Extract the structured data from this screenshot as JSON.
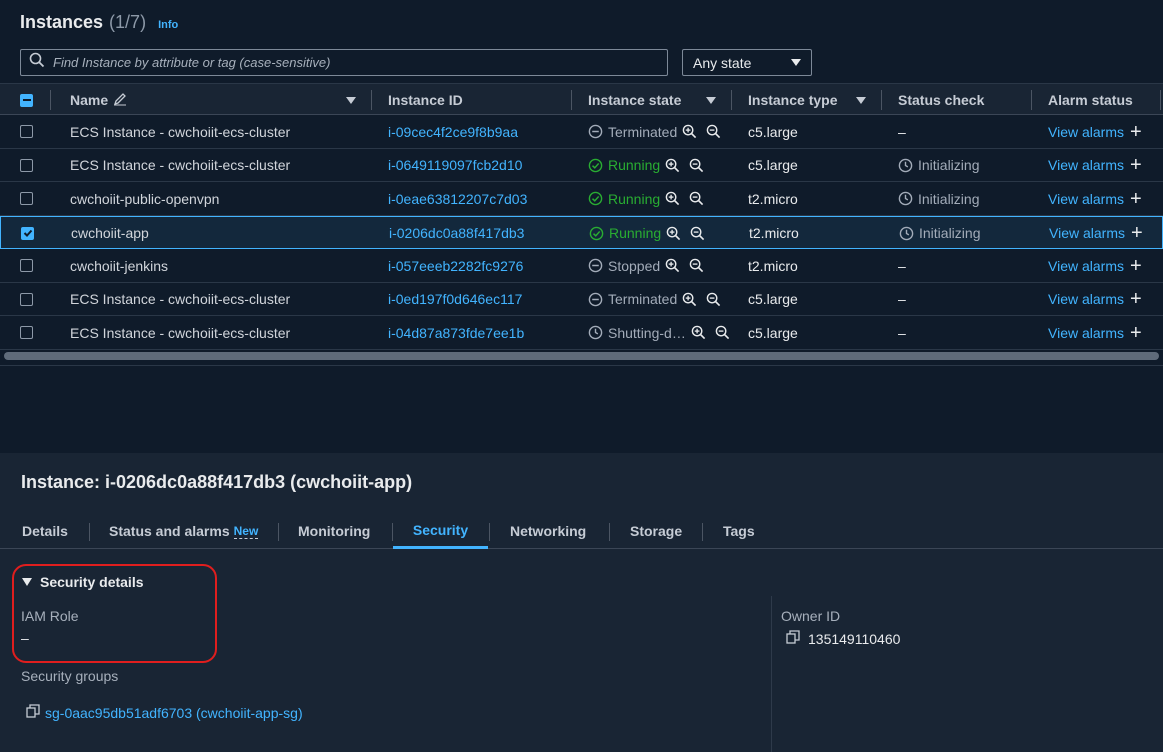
{
  "header": {
    "title": "Instances",
    "count": "(1/7)",
    "info": "Info"
  },
  "search": {
    "placeholder": "Find Instance by attribute or tag (case-sensitive)",
    "value": ""
  },
  "state_filter": {
    "selected": "Any state"
  },
  "table": {
    "columns": {
      "name": "Name",
      "instance_id": "Instance ID",
      "instance_state": "Instance state",
      "instance_type": "Instance type",
      "status_check": "Status check",
      "alarm_status": "Alarm status"
    },
    "rows": [
      {
        "name": "ECS Instance - cwchoiit-ecs-cluster",
        "id": "i-09cec4f2ce9f8b9aa",
        "state": "Terminated",
        "type": "c5.large",
        "status": "–",
        "alarm": "View alarms"
      },
      {
        "name": "ECS Instance - cwchoiit-ecs-cluster",
        "id": "i-0649119097fcb2d10",
        "state": "Running",
        "type": "c5.large",
        "status": "Initializing",
        "alarm": "View alarms"
      },
      {
        "name": "cwchoiit-public-openvpn",
        "id": "i-0eae63812207c7d03",
        "state": "Running",
        "type": "t2.micro",
        "status": "Initializing",
        "alarm": "View alarms"
      },
      {
        "name": "cwchoiit-app",
        "id": "i-0206dc0a88f417db3",
        "state": "Running",
        "type": "t2.micro",
        "status": "Initializing",
        "alarm": "View alarms"
      },
      {
        "name": "cwchoiit-jenkins",
        "id": "i-057eeeb2282fc9276",
        "state": "Stopped",
        "type": "t2.micro",
        "status": "–",
        "alarm": "View alarms"
      },
      {
        "name": "ECS Instance - cwchoiit-ecs-cluster",
        "id": "i-0ed197f0d646ec117",
        "state": "Terminated",
        "type": "c5.large",
        "status": "–",
        "alarm": "View alarms"
      },
      {
        "name": "ECS Instance - cwchoiit-ecs-cluster",
        "id": "i-04d87a873fde7ee1b",
        "state": "Shutting-d…",
        "type": "c5.large",
        "status": "–",
        "alarm": "View alarms"
      }
    ]
  },
  "detail": {
    "title": "Instance: i-0206dc0a88f417db3 (cwchoiit-app)",
    "tabs": [
      "Details",
      "Status and alarms",
      "Monitoring",
      "Security",
      "Networking",
      "Storage",
      "Tags"
    ],
    "new_badge": "New",
    "section": "Security details",
    "iam_role_label": "IAM Role",
    "iam_role_value": "–",
    "owner_id_label": "Owner ID",
    "owner_id_value": "135149110460",
    "security_groups_label": "Security groups",
    "security_group_value": "sg-0aac95db51adf6703 (cwchoiit-app-sg)"
  },
  "colors": {
    "accent": "#42b4ff",
    "running": "#29ad32",
    "annotation": "#e01e1e"
  }
}
